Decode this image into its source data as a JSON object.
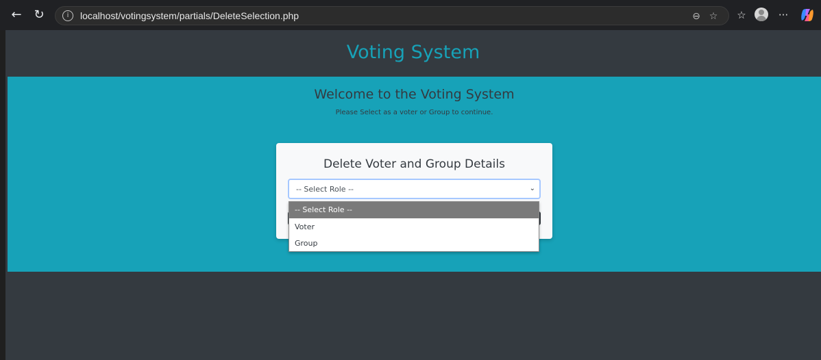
{
  "browser": {
    "url": "localhost/votingsystem/partials/DeleteSelection.php"
  },
  "page": {
    "site_title": "Voting System",
    "welcome_title": "Welcome to the Voting System",
    "welcome_subtitle": "Please Select as a voter or Group to continue.",
    "card_title": "Delete Voter and Group Details",
    "role_select": {
      "value": "-- Select Role --",
      "options": [
        "-- Select Role --",
        "Voter",
        "Group"
      ]
    }
  },
  "colors": {
    "accent": "#17a2b8",
    "page_dark": "#343a40",
    "card": "#f8f9fa"
  }
}
